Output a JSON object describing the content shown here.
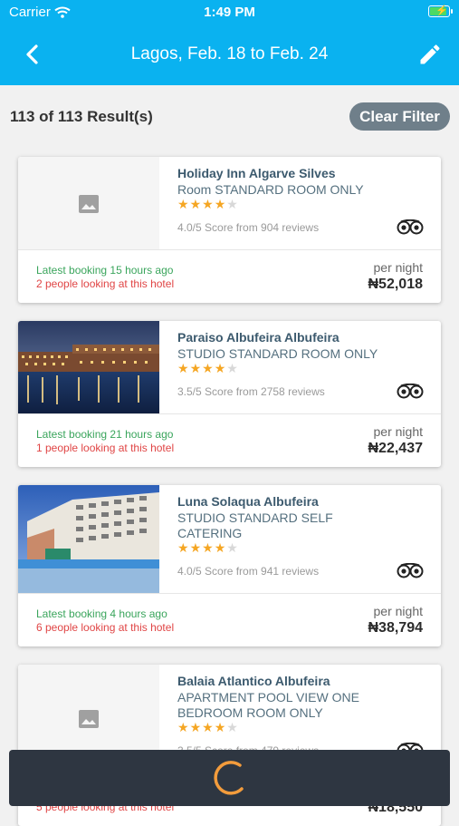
{
  "status_bar": {
    "carrier": "Carrier",
    "time": "1:49 PM",
    "battery_level": 0.9
  },
  "nav": {
    "title": "Lagos, Feb. 18 to Feb. 24",
    "back_icon": "chevron-left-icon",
    "edit_icon": "pencil-icon"
  },
  "results": {
    "count_text": "113 of  113 Result(s)",
    "clear_filter_label": "Clear Filter"
  },
  "hotels": [
    {
      "name": "Holiday Inn Algarve Silves",
      "room": "Room STANDARD ROOM ONLY",
      "stars": 4,
      "max_stars": 5,
      "score": "4.0/5 Score from 904 reviews",
      "latest_booking": "Latest booking 15 hours ago",
      "people_looking": "2 people looking at this hotel",
      "per_night": "per night",
      "price": "₦52,018",
      "image": "placeholder"
    },
    {
      "name": "Paraiso Albufeira Albufeira",
      "room": "STUDIO STANDARD ROOM ONLY",
      "stars": 4,
      "max_stars": 5,
      "score": "3.5/5 Score from 2758 reviews",
      "latest_booking": "Latest booking 21 hours ago",
      "people_looking": "1 people looking at this hotel",
      "per_night": "per night",
      "price": "₦22,437",
      "image": "hotel-photo-dusk"
    },
    {
      "name": "Luna Solaqua Albufeira",
      "room": "STUDIO STANDARD SELF CATERING",
      "stars": 4,
      "max_stars": 5,
      "score": "4.0/5 Score from 941 reviews",
      "latest_booking": "Latest booking 4 hours ago",
      "people_looking": "6 people looking at this hotel",
      "per_night": "per night",
      "price": "₦38,794",
      "image": "hotel-photo-day"
    },
    {
      "name": "Balaia Atlantico Albufeira",
      "room": "APARTMENT POOL VIEW ONE BEDROOM ROOM ONLY",
      "stars": 4,
      "max_stars": 5,
      "score": "3.5/5 Score from 479 reviews",
      "latest_booking": "",
      "people_looking": "5 people looking at this hotel",
      "per_night": "",
      "price": "₦18,550",
      "image": "placeholder"
    }
  ],
  "colors": {
    "header": "#0ab2f0",
    "clear_filter_bg": "#6f7f8a",
    "hotel_name": "#3c5a6e",
    "star": "#f5a623",
    "booking_green": "#3aa55c",
    "looking_red": "#e04545",
    "spinner": "#f39c3c",
    "loading_bg": "#2e3641"
  }
}
